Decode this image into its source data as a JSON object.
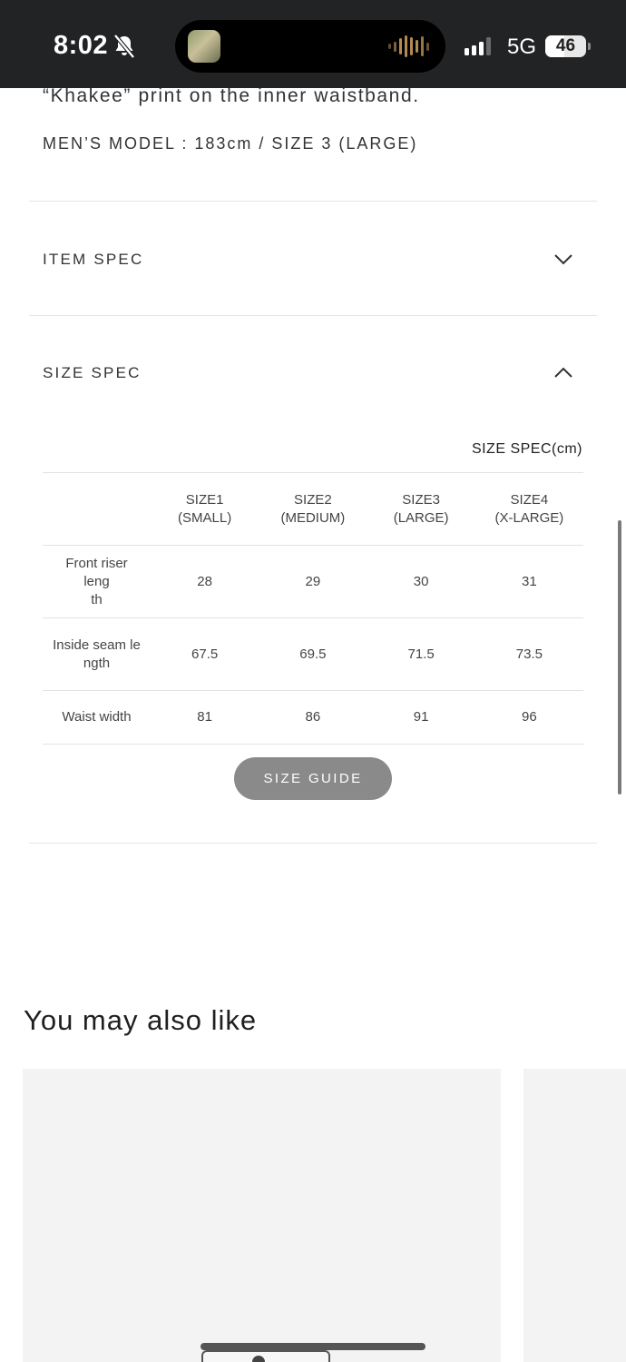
{
  "status_bar": {
    "time": "8:02",
    "network": "5G",
    "battery": "46",
    "battery_level": 0.46
  },
  "description": {
    "print_line": "“Khakee” print on the inner waistband.",
    "model_line": "MEN’S MODEL : 183cm / SIZE 3 (LARGE)"
  },
  "accordion": {
    "item_spec_title": "ITEM SPEC",
    "size_spec_title": "SIZE SPEC"
  },
  "size_table": {
    "unit_label": "SIZE SPEC(cm)",
    "headers": [
      {
        "line1": "SIZE1",
        "line2": "(SMALL)"
      },
      {
        "line1": "SIZE2",
        "line2": "(MEDIUM)"
      },
      {
        "line1": "SIZE3",
        "line2": "(LARGE)"
      },
      {
        "line1": "SIZE4",
        "line2": "(X-LARGE)"
      }
    ],
    "rows": [
      {
        "label_line1": "Front riser leng",
        "label_line2": "th",
        "values": [
          "28",
          "29",
          "30",
          "31"
        ]
      },
      {
        "label_line1": "Inside seam le",
        "label_line2": "ngth",
        "values": [
          "67.5",
          "69.5",
          "71.5",
          "73.5"
        ]
      },
      {
        "label_line1": "Waist width",
        "label_line2": "",
        "values": [
          "81",
          "86",
          "91",
          "96"
        ]
      }
    ]
  },
  "size_guide_label": "SIZE GUIDE",
  "recommendations": {
    "title": "You may also like"
  }
}
